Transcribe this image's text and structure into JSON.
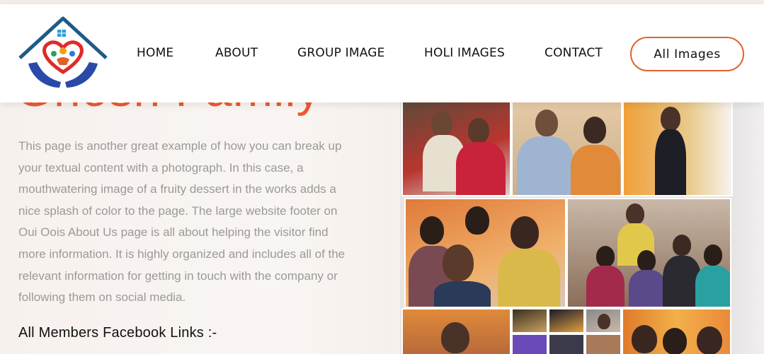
{
  "nav": {
    "items": [
      "HOME",
      "ABOUT",
      "GROUP IMAGE",
      "HOLI IMAGES",
      "CONTACT"
    ],
    "cta_label": "All Images"
  },
  "hero": {
    "title_partial": "Ghosh Family",
    "description": "This page is another great example of how you can break up your textual content with a photograph. In this case, a mouthwatering image of a fruity dessert in the works adds a nice splash of color to the page. The large website footer on Oui Oois About Us page is all about helping the visitor find more information. It is highly organized and includes all of the relevant information for getting in touch with the company or following them on social media.",
    "fb_heading": "All Members Facebook Links :-"
  },
  "colors": {
    "accent": "#ef5a2f",
    "cta_border": "#e0622f",
    "body_text": "#9a9a9a"
  },
  "gallery": {
    "icon": "photo-collage"
  }
}
